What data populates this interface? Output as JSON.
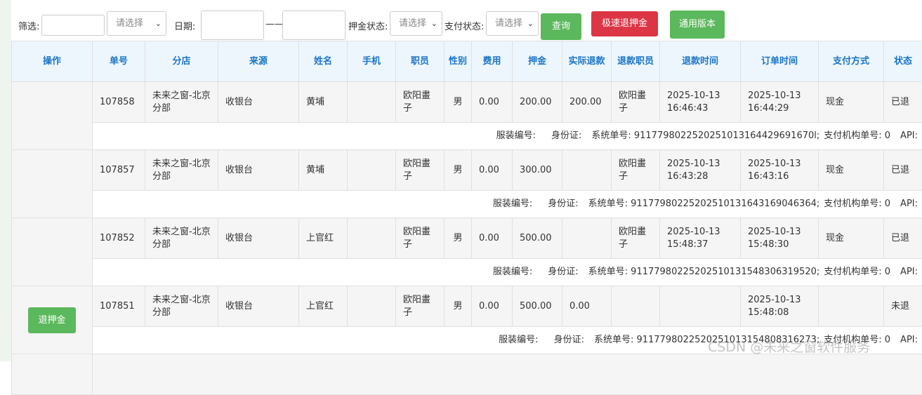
{
  "filters": {
    "filter_label": "筛选:",
    "filter_value": "",
    "select_placeholder": "请选择",
    "date_label": "日期:",
    "date_from": "",
    "date_sep": "——",
    "date_to": "",
    "deposit_status_label": "押金状态:",
    "deposit_status_value": "请选择",
    "pay_status_label": "支付状态:",
    "pay_status_value": "请选择",
    "query_button": "查询",
    "quick_refund_button": "极速退押金",
    "general_version_button": "通用版本"
  },
  "table": {
    "headers": [
      "操作",
      "单号",
      "分店",
      "来源",
      "姓名",
      "手机",
      "职员",
      "性别",
      "费用",
      "押金",
      "实际退款",
      "退款职员",
      "退款时间",
      "订单时间",
      "支付方式",
      "状态"
    ],
    "rows": [
      {
        "action": "",
        "order_no": "107858",
        "store": "未来之窗-北京分部",
        "source": "收银台",
        "name": "黄埔",
        "phone": "",
        "staff": "欧阳畫子",
        "gender": "男",
        "fee": "0.00",
        "deposit": "200.00",
        "refund_actual": "200.00",
        "refund_staff": "欧阳畫子",
        "refund_time": "2025-10-13 16:46:43",
        "order_time": "2025-10-13 16:44:29",
        "pay_method": "现金",
        "status": "已退",
        "detail": {
          "clothing_no": "服装编号:",
          "id_card": "身份证:",
          "system_no": "系统单号: 9117798022520251013164429691670l;",
          "pay_org_no": "支付机构单号: 0",
          "api": "API:"
        }
      },
      {
        "action": "",
        "order_no": "107857",
        "store": "未来之窗-北京分部",
        "source": "收银台",
        "name": "黄埔",
        "phone": "",
        "staff": "欧阳畫子",
        "gender": "男",
        "fee": "0.00",
        "deposit": "300.00",
        "refund_actual": "",
        "refund_staff": "欧阳畫子",
        "refund_time": "2025-10-13 16:43:28",
        "order_time": "2025-10-13 16:43:16",
        "pay_method": "现金",
        "status": "已退",
        "detail": {
          "clothing_no": "服装编号:",
          "id_card": "身份证:",
          "system_no": "系统单号: 9117798022520251013164316904636​4;",
          "pay_org_no": "支付机构单号: 0",
          "api": "API:"
        }
      },
      {
        "action": "",
        "order_no": "107852",
        "store": "未来之窗-北京分部",
        "source": "收银台",
        "name": "上官红",
        "phone": "",
        "staff": "欧阳畫子",
        "gender": "男",
        "fee": "0.00",
        "deposit": "500.00",
        "refund_actual": "",
        "refund_staff": "欧阳畫子",
        "refund_time": "2025-10-13 15:48:37",
        "order_time": "2025-10-13 15:48:30",
        "pay_method": "现金",
        "status": "已退",
        "detail": {
          "clothing_no": "服装编号:",
          "id_card": "身份证:",
          "system_no": "系统单号: 9117798022520251013154830631952​0;",
          "pay_org_no": "支付机构单号: 0",
          "api": "API:"
        }
      },
      {
        "action": "退押金",
        "order_no": "107851",
        "store": "未来之窗-北京分部",
        "source": "收银台",
        "name": "上官红",
        "phone": "",
        "staff": "欧阳畫子",
        "gender": "男",
        "fee": "0.00",
        "deposit": "500.00",
        "refund_actual": "0.00",
        "refund_staff": "",
        "refund_time": "",
        "order_time": "2025-10-13 15:48:08",
        "pay_method": "",
        "status": "未退",
        "detail": {
          "clothing_no": "服装编号:",
          "id_card": "身份证:",
          "system_no": "系统单号: 911779802252025101315480831627​3;",
          "pay_org_no": "支付机构单号: 0",
          "api": "API:"
        }
      }
    ]
  },
  "watermark": "CSDN @未来之窗软件服务",
  "colors": {
    "header_text": "#1a75c7",
    "header_bg": "#eef6fd",
    "green": "#5cb85c",
    "red": "#dc3545",
    "refunded": "#e00000"
  }
}
